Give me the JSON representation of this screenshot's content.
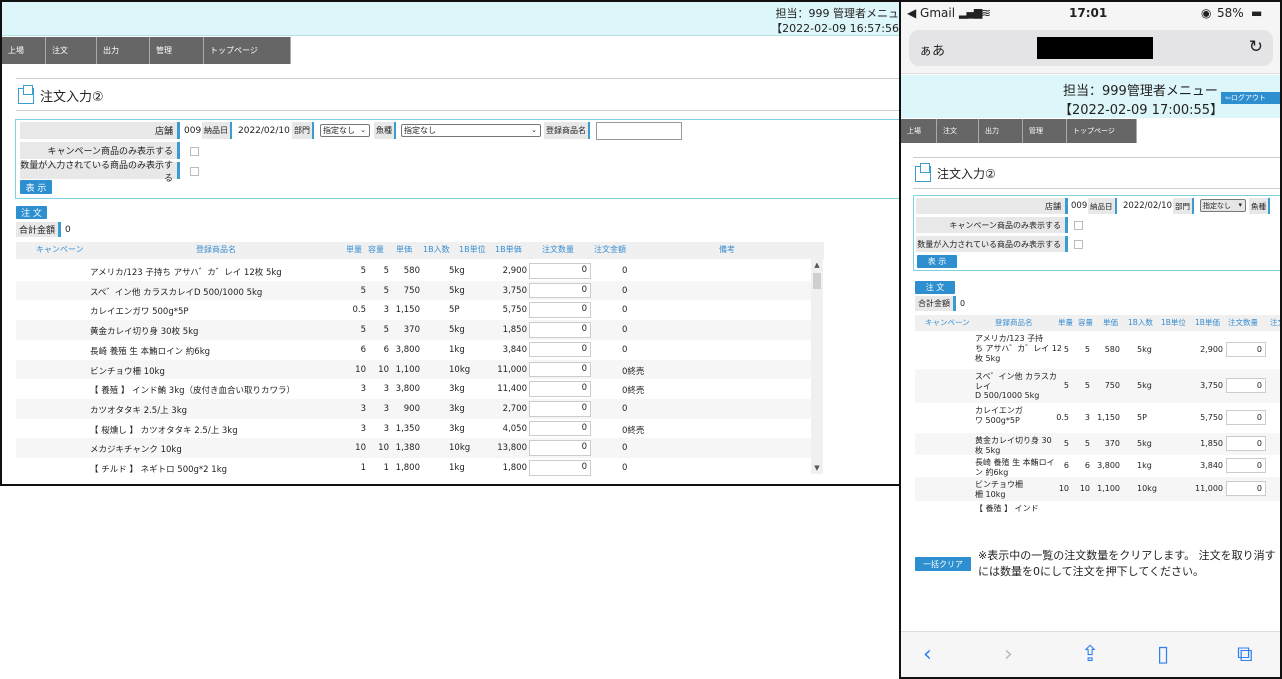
{
  "desktop": {
    "header_line1": "担当：999 管理者メニュ",
    "header_line2": "【2022-02-09 16:57:56",
    "nav": [
      "上場",
      "注文",
      "出力",
      "管理",
      "トップページ"
    ],
    "page_title": "注文入力②",
    "filter": {
      "store_label": "店舗",
      "store_value": "009",
      "delivery_label": "納品日",
      "delivery_value": "2022/02/10",
      "dept_label": "部門",
      "dept_select": "指定なし",
      "fish_label": "魚種",
      "fish_select": "指定なし",
      "product_label": "登録商品名",
      "campaign_only": "キャンペーン商品のみ表示する",
      "qty_only": "数量が入力されている商品のみ表示する",
      "show_button": "表 示"
    },
    "order_button": "注 文",
    "total_label": "合計金額",
    "total_value": "0",
    "columns": [
      "キャンペーン",
      "登録商品名",
      "単量",
      "容量",
      "単価",
      "1B入数",
      "1B単位",
      "1B単価",
      "注文数量",
      "注文金額",
      "備考"
    ],
    "rows": [
      {
        "name": "アメリカ/123 子持ち アサハ゛カ゛レイ 12枚 5kg",
        "unit": "5",
        "cap": "5",
        "price": "580",
        "qty1b": "5kg",
        "unit1b": "",
        "price1b": "2,900",
        "qty": "0",
        "amount": "0",
        "note": ""
      },
      {
        "name": "スペ゛イン他 カラスカレイD 500/1000 5kg",
        "unit": "5",
        "cap": "5",
        "price": "750",
        "qty1b": "5kg",
        "unit1b": "",
        "price1b": "3,750",
        "qty": "0",
        "amount": "0",
        "note": ""
      },
      {
        "name": "カレイエンガワ 500g*5P",
        "unit": "0.5",
        "cap": "3",
        "price": "1,150",
        "qty1b": "5P",
        "unit1b": "",
        "price1b": "5,750",
        "qty": "0",
        "amount": "0",
        "note": ""
      },
      {
        "name": "黄金カレイ切り身 30枚 5kg",
        "unit": "5",
        "cap": "5",
        "price": "370",
        "qty1b": "5kg",
        "unit1b": "",
        "price1b": "1,850",
        "qty": "0",
        "amount": "0",
        "note": ""
      },
      {
        "name": "長崎 養殖 生 本鮪ロイン 約6kg",
        "unit": "6",
        "cap": "6",
        "price": "3,800",
        "qty1b": "1kg",
        "unit1b": "",
        "price1b": "3,840",
        "qty": "0",
        "amount": "0",
        "note": ""
      },
      {
        "name": "ビンチョウ柵 10kg",
        "unit": "10",
        "cap": "10",
        "price": "1,100",
        "qty1b": "10kg",
        "unit1b": "",
        "price1b": "11,000",
        "qty": "0",
        "amount": "0終売",
        "note": ""
      },
      {
        "name": "【 養殖 】 インド鮪 3kg（皮付き血合い取りカワラ）",
        "unit": "3",
        "cap": "3",
        "price": "3,800",
        "qty1b": "3kg",
        "unit1b": "",
        "price1b": "11,400",
        "qty": "0",
        "amount": "0終売",
        "note": ""
      },
      {
        "name": "カツオタタキ 2.5/上 3kg",
        "unit": "3",
        "cap": "3",
        "price": "900",
        "qty1b": "3kg",
        "unit1b": "",
        "price1b": "2,700",
        "qty": "0",
        "amount": "0",
        "note": ""
      },
      {
        "name": "【 桜燻し 】 カツオタタキ 2.5/上 3kg",
        "unit": "3",
        "cap": "3",
        "price": "1,350",
        "qty1b": "3kg",
        "unit1b": "",
        "price1b": "4,050",
        "qty": "0",
        "amount": "0終売",
        "note": ""
      },
      {
        "name": "メカジキチャンク 10kg",
        "unit": "10",
        "cap": "10",
        "price": "1,380",
        "qty1b": "10kg",
        "unit1b": "",
        "price1b": "13,800",
        "qty": "0",
        "amount": "0",
        "note": ""
      },
      {
        "name": "【 チルド 】 ネギトロ 500g*2 1kg",
        "unit": "1",
        "cap": "1",
        "price": "1,800",
        "qty1b": "1kg",
        "unit1b": "",
        "price1b": "1,800",
        "qty": "0",
        "amount": "0",
        "note": ""
      }
    ]
  },
  "phone": {
    "status_left": "◀ Gmail",
    "status_time": "17:01",
    "status_battery": "58%",
    "url_aa": "ぁあ",
    "header_line1": "担当：999管理者メニュー",
    "header_line2": "【2022-02-09 17:00:55】",
    "logout": "ログアウト",
    "nav": [
      "上場",
      "注文",
      "出力",
      "管理",
      "トップページ"
    ],
    "page_title": "注文入力②",
    "filter": {
      "store_label": "店舗",
      "store_value": "009",
      "delivery_label": "納品日",
      "delivery_value": "2022/02/10",
      "dept_label": "部門",
      "dept_select": "指定なし",
      "fish_label": "魚種",
      "campaign_only": "キャンペーン商品のみ表示する",
      "qty_only": "数量が入力されている商品のみ表示する",
      "show_button": "表 示"
    },
    "order_button": "注 文",
    "total_label": "合計金額",
    "total_value": "0",
    "columns": [
      "キャンペーン",
      "登録商品名",
      "単量",
      "容量",
      "単価",
      "1B入数",
      "1B単位",
      "1B単価",
      "注文数量",
      "注文"
    ],
    "rows": [
      {
        "name1": "アメリカ/123 子持",
        "name2": "ち アサハ゛カ゛レイ 12",
        "name3": "枚 5kg",
        "unit": "5",
        "cap": "5",
        "price": "580",
        "qty1b": "5kg",
        "price1b": "2,900",
        "qty": "0"
      },
      {
        "name1": "スペ゛イン他 カラスカ",
        "name2": "レイ",
        "name3": "D 500/1000 5kg",
        "unit": "5",
        "cap": "5",
        "price": "750",
        "qty1b": "5kg",
        "price1b": "3,750",
        "qty": "0"
      },
      {
        "name1": "カレイエンガ",
        "name2": "ワ 500g*5P",
        "name3": "",
        "unit": "0.5",
        "cap": "3",
        "price": "1,150",
        "qty1b": "5P",
        "price1b": "5,750",
        "qty": "0"
      },
      {
        "name1": "黄金カレイ切り身 30",
        "name2": "枚 5kg",
        "name3": "",
        "unit": "5",
        "cap": "5",
        "price": "370",
        "qty1b": "5kg",
        "price1b": "1,850",
        "qty": "0"
      },
      {
        "name1": "長崎 養殖 生 本鮪ロイ",
        "name2": "ン 約6kg",
        "name3": "",
        "unit": "6",
        "cap": "6",
        "price": "3,800",
        "qty1b": "1kg",
        "price1b": "3,840",
        "qty": "0"
      },
      {
        "name1": "ビンチョウ柵",
        "name2": "柵 10kg",
        "name3": "",
        "unit": "10",
        "cap": "10",
        "price": "1,100",
        "qty1b": "10kg",
        "price1b": "11,000",
        "qty": "0"
      },
      {
        "name1": "【 養殖 】 インド",
        "name2": "",
        "name3": "",
        "unit": "",
        "cap": "",
        "price": "",
        "qty1b": "",
        "price1b": "",
        "qty": ""
      }
    ],
    "clear_button": "一括クリア",
    "notice_line1": "※表示中の一覧の注文数量をクリアします。 注文を取り消す",
    "notice_line2": "には数量を0にして注文を押下してください。"
  }
}
